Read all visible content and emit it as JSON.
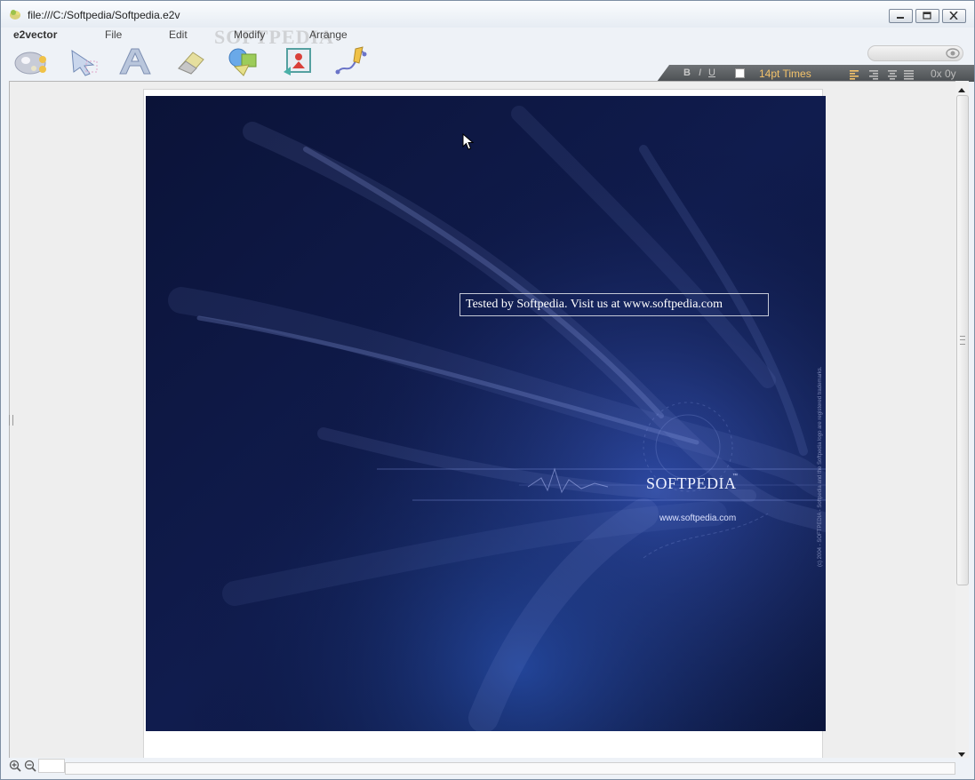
{
  "window": {
    "title": "file:///C:/Softpedia/Softpedia.e2v"
  },
  "menu": {
    "app": "e2vector",
    "file": "File",
    "edit": "Edit",
    "modify": "Modify",
    "arrange": "Arrange"
  },
  "watermark": "SOFTPEDIA",
  "toolbar": {
    "tools": [
      "palette-icon",
      "select-arrow-icon",
      "text-tool-icon",
      "eraser-icon",
      "shapes-icon",
      "image-insert-icon",
      "pen-path-icon"
    ]
  },
  "format_bar": {
    "bold": "B",
    "italic": "I",
    "underline": "U",
    "fill_color": "#ffffff",
    "font": "14pt Times",
    "coords": "0x  0y"
  },
  "canvas": {
    "textbox_text": "Tested by Softpedia. Visit us at www.softpedia.com",
    "logo_text": "SOFTPEDIA",
    "logo_tm": "™",
    "logo_url": "www.softpedia.com",
    "side_notice": "(c) 2004 - SOFTPEDIA - Softpedia and the Softpedia logo are registered trademarks."
  },
  "colors": {
    "image_bg": "#0a1236",
    "format_bar_bg": "#5c6063",
    "font_label": "#f3c26a"
  }
}
